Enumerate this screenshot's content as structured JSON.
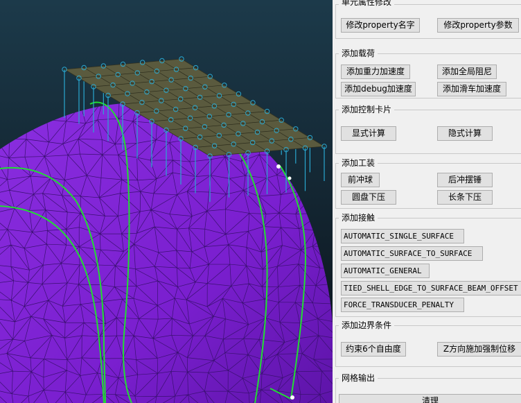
{
  "colors": {
    "background_top": "#1c3a4a",
    "background_bottom": "#0a1018",
    "mesh_fill": "#7a1fcf",
    "mesh_line": "#3a1070",
    "feature_line": "#22dd33",
    "plate_fill": "#5a5a3e",
    "pin": "#2aa8d0",
    "panel_bg": "#f0f0f0"
  },
  "panel": {
    "groups": [
      {
        "title": "单元属性修改",
        "buttons": [
          "修改property名字",
          "修改property参数"
        ]
      },
      {
        "title": "添加载荷",
        "buttons": [
          "添加重力加速度",
          "添加全局阻尼",
          "添加debug加速度",
          "添加滑车加速度"
        ]
      },
      {
        "title": "添加控制卡片",
        "buttons": [
          "显式计算",
          "隐式计算"
        ]
      },
      {
        "title": "添加工装",
        "buttons": [
          "前冲球",
          "后冲摆锤",
          "圆盘下压",
          "长条下压"
        ]
      },
      {
        "title": "添加接触",
        "buttons": [
          "AUTOMATIC_SINGLE_SURFACE",
          "AUTOMATIC_SURFACE_TO_SURFACE",
          "AUTOMATIC_GENERAL",
          "TIED_SHELL_EDGE_TO_SURFACE_BEAM_OFFSET",
          "FORCE_TRANSDUCER_PENALTY"
        ]
      },
      {
        "title": "添加边界条件",
        "buttons": [
          "约束6个自由度",
          "Z方向施加强制位移"
        ]
      },
      {
        "title": "网格输出",
        "buttons": [
          "清理"
        ]
      }
    ]
  }
}
